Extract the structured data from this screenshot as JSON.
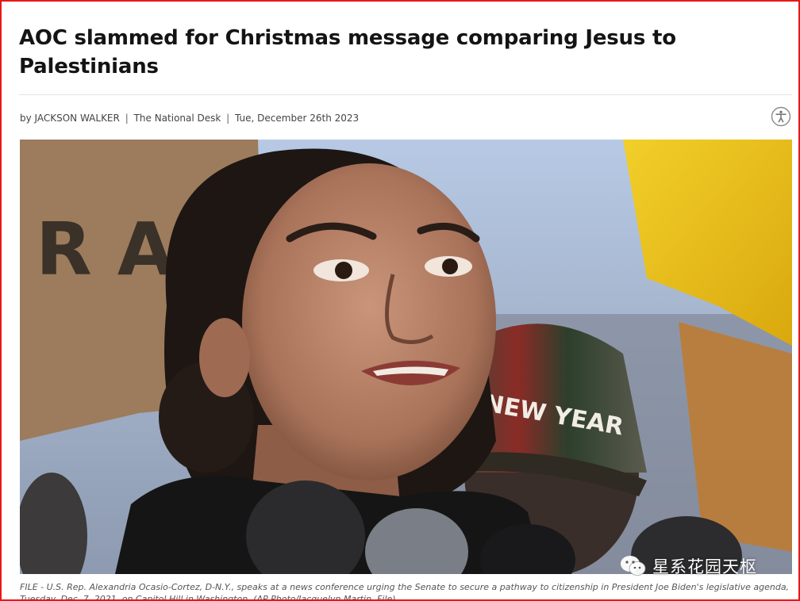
{
  "article": {
    "headline": "AOC slammed for Christmas message comparing Jesus to Palestinians",
    "byline": {
      "author": "by JACKSON WALKER",
      "outlet": "The National Desk",
      "date": "Tue, December 26th 2023",
      "separator": "|"
    },
    "photo": {
      "sign_letters": "R A",
      "hat_text": "NEW YEAR"
    },
    "caption": "FILE - U.S. Rep. Alexandria Ocasio-Cortez, D-N.Y., speaks at a news conference urging the Senate to secure a pathway to citizenship in President Joe Biden's legislative agenda, Tuesday, Dec. 7, 2021, on Capitol Hill in Washington. (AP Photo/Jacquelyn Martin, File)"
  },
  "accessibility_button": {
    "icon": "accessibility-icon"
  },
  "watermark": {
    "icon": "wechat-icon",
    "text": "星系花园天枢"
  },
  "colors": {
    "frame_border": "#e8161b",
    "headline": "#141414",
    "byline": "#444444",
    "caption": "#555555"
  }
}
